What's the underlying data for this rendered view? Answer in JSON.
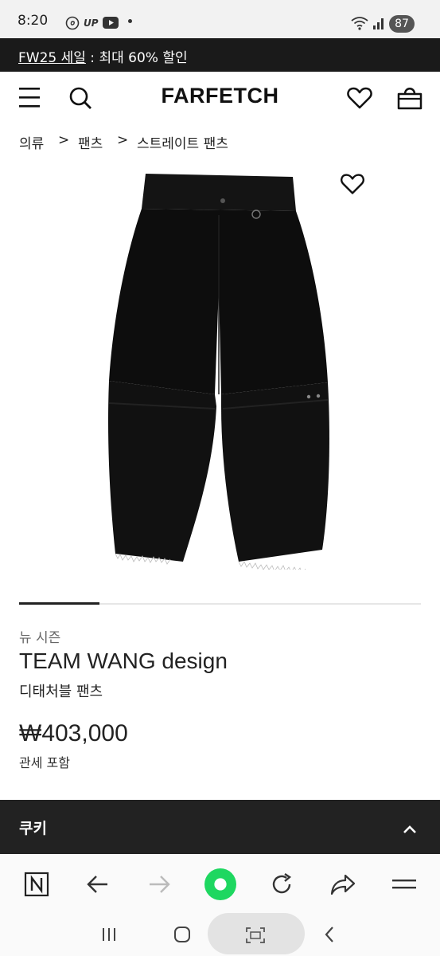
{
  "status": {
    "time": "8:20",
    "carrier_badge": "UP",
    "battery": "87"
  },
  "promo": {
    "link": "FW25 세일",
    "text": " : 최대 60% 할인"
  },
  "header": {
    "logo": "FARFETCH"
  },
  "breadcrumb": [
    {
      "label": "의류"
    },
    {
      "label": "팬츠"
    },
    {
      "label": "스트레이트 팬츠"
    }
  ],
  "breadcrumb_separator": ">",
  "product": {
    "badge": "뉴 시즌",
    "brand": "TEAM WANG design",
    "name": "디태처블 팬츠",
    "price": "₩403,000",
    "price_note": "관세 포함",
    "image_progress": 0.2
  },
  "cookie": {
    "title": "쿠키"
  },
  "icons": {
    "menu": "menu-icon",
    "search": "search-icon",
    "wishlist": "heart-icon",
    "bag": "bag-icon",
    "back": "arrow-left-icon",
    "forward": "arrow-right-icon",
    "refresh": "refresh-icon",
    "share": "share-icon",
    "more": "hamburger-icon",
    "tabs": "n-tab-icon",
    "home": "home-circle-icon"
  },
  "colors": {
    "promo_bg": "#1a1a1a",
    "cookie_bg": "#222222",
    "home_accent": "#1ed760",
    "text": "#222222"
  }
}
